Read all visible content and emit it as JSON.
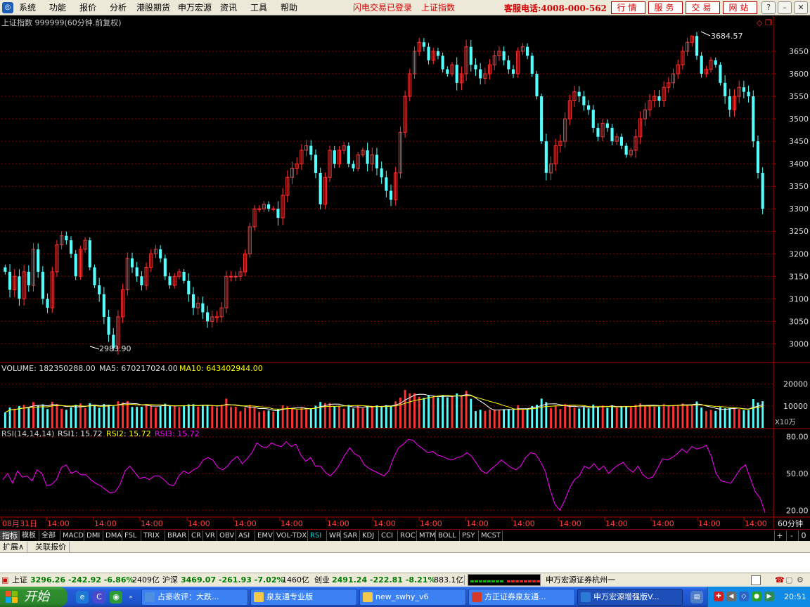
{
  "menu": {
    "items": [
      "系统",
      "功能",
      "报价",
      "分析",
      "港股期货",
      "申万宏源",
      "资讯",
      "工具",
      "帮助"
    ],
    "status_login": "闪电交易已登录",
    "status_index": "上证指数",
    "hotline": "客服电话:4008-000-562",
    "quick_buttons": [
      "行情",
      "服务",
      "交易",
      "网站"
    ],
    "window_buttons": [
      "?",
      "–",
      "❐",
      "✕"
    ]
  },
  "chart_header": {
    "title": "上证指数 999999(60分钟.前复权)",
    "high_label": "3684.57",
    "low_label": "2983.90"
  },
  "volume_header": {
    "volume": "VOLUME: 182350288.00",
    "ma5": "MA5: 670217024.00",
    "ma10": "MA10: 643402944.00",
    "unit": "X10万"
  },
  "rsi_header": {
    "name": "RSI(14,14,14)",
    "rsi1": "RSI1: 15.72",
    "rsi2": "RSI2: 15.72",
    "rsi3": "RSI3: 15.72"
  },
  "time_axis": {
    "labels": [
      "08月31日",
      "14:00",
      "14:00",
      "14:00",
      "14:00",
      "14:00",
      "14:00",
      "14:00",
      "14:00",
      "14:00",
      "14:00",
      "14:00",
      "14:00",
      "14:00",
      "14:00",
      "14:00",
      "14:00",
      "14:00"
    ],
    "period": "60分钟"
  },
  "indicator_tabs": [
    "指标",
    "模板",
    "全部",
    "MACD",
    "DMI",
    "DMA",
    "FSL",
    "TRIX",
    "BRAR",
    "CR",
    "VR",
    "OBV",
    "ASI",
    "EMV",
    "VOL-TDX",
    "RSI",
    "WR",
    "SAR",
    "KDJ",
    "CCI",
    "ROC",
    "MTM",
    "BOLL",
    "PSY",
    "MCST"
  ],
  "selected_tab": "RSI",
  "tab_controls": [
    "+",
    "-",
    "0"
  ],
  "ext_tabs": [
    "扩展∧",
    "关联报价"
  ],
  "status_bar": {
    "sh_label": "上证",
    "sh_value": "3296.26 -242.92 -6.86%",
    "sh_amount": "2409亿",
    "hs_label": "沪深",
    "hs_value": "3469.07 -261.93 -7.02%",
    "hs_amount": "1460亿",
    "cy_label": "创业",
    "cy_value": "2491.24 -222.81 -8.21%",
    "cy_amount": "883.1亿",
    "broker": "申万宏源证券杭州一"
  },
  "taskbar": {
    "start": "开始",
    "tasks": [
      "占豪收评：大跌...",
      "泉友通专业版",
      "new_swhy_v6",
      "方正证券泉友通...",
      "申万宏源增强版V..."
    ],
    "clock": "20:51"
  },
  "colors": {
    "up": "#ff3232",
    "down": "#54ffff",
    "ma5": "#ffffff",
    "ma10": "#ffff00",
    "rsi": "#ff00ff",
    "grid": "#8b0000"
  },
  "chart_data": [
    {
      "type": "candlestick",
      "title": "上证指数 999999(60分钟.前复权)",
      "x_labels": [
        "08月31日",
        "14:00",
        "14:00",
        "14:00",
        "14:00",
        "14:00",
        "14:00",
        "14:00",
        "14:00",
        "14:00",
        "14:00",
        "14:00",
        "14:00",
        "14:00",
        "14:00",
        "14:00",
        "14:00",
        "14:00"
      ],
      "ylim": [
        2960,
        3700
      ],
      "yticks": [
        3000,
        3050,
        3100,
        3150,
        3200,
        3250,
        3300,
        3350,
        3400,
        3450,
        3500,
        3550,
        3600,
        3650
      ],
      "close": [
        3160,
        3120,
        3150,
        3100,
        3160,
        3130,
        3210,
        3160,
        3100,
        3080,
        3160,
        3220,
        3240,
        3230,
        3200,
        3150,
        3210,
        3230,
        3170,
        3130,
        3110,
        3060,
        3020,
        2990,
        3060,
        3120,
        3190,
        3170,
        3150,
        3130,
        3170,
        3200,
        3210,
        3190,
        3150,
        3130,
        3150,
        3160,
        3140,
        3110,
        3080,
        3090,
        3070,
        3050,
        3060,
        3060,
        3080,
        3150,
        3150,
        3150,
        3160,
        3200,
        3260,
        3300,
        3300,
        3310,
        3300,
        3300,
        3280,
        3330,
        3370,
        3390,
        3400,
        3430,
        3440,
        3420,
        3380,
        3310,
        3370,
        3430,
        3400,
        3430,
        3440,
        3400,
        3390,
        3420,
        3430,
        3400,
        3420,
        3390,
        3370,
        3340,
        3320,
        3380,
        3470,
        3550,
        3600,
        3650,
        3670,
        3660,
        3630,
        3650,
        3640,
        3610,
        3600,
        3620,
        3580,
        3600,
        3660,
        3620,
        3610,
        3590,
        3600,
        3620,
        3640,
        3650,
        3630,
        3610,
        3600,
        3650,
        3660,
        3640,
        3600,
        3550,
        3450,
        3380,
        3400,
        3440,
        3450,
        3500,
        3540,
        3560,
        3550,
        3530,
        3520,
        3480,
        3460,
        3490,
        3480,
        3450,
        3460,
        3440,
        3420,
        3430,
        3460,
        3500,
        3520,
        3540,
        3550,
        3540,
        3570,
        3580,
        3600,
        3620,
        3650,
        3670,
        3684,
        3640,
        3600,
        3610,
        3630,
        3620,
        3580,
        3550,
        3520,
        3550,
        3570,
        3560,
        3550,
        3450,
        3380,
        3300
      ],
      "high": 3684.57,
      "low": 2983.9
    },
    {
      "type": "bar",
      "title": "VOLUME",
      "unit": "X10万",
      "ylim": [
        0,
        25000
      ],
      "yticks": [
        10000,
        20000
      ],
      "series": [
        {
          "name": "MA5",
          "value": 670217024.0
        },
        {
          "name": "MA10",
          "value": 643402944.0
        }
      ]
    },
    {
      "type": "line",
      "title": "RSI(14,14,14)",
      "ylim": [
        15,
        85
      ],
      "yticks": [
        20,
        50,
        80
      ],
      "series": [
        {
          "name": "RSI1",
          "values": [
            45,
            50,
            42,
            52,
            47,
            48,
            44,
            53,
            50,
            40,
            41,
            45,
            55,
            57,
            50,
            52,
            49,
            49,
            45,
            42,
            40,
            37,
            34,
            35,
            41,
            52,
            56,
            51,
            46,
            47,
            45,
            48,
            48,
            45,
            41,
            40,
            48,
            52,
            50,
            53,
            55,
            61,
            63,
            61,
            55,
            53,
            56,
            61,
            64,
            58,
            62,
            67,
            75,
            72,
            71,
            75,
            73,
            72,
            76,
            72,
            74,
            65,
            60,
            63,
            56,
            56,
            51,
            48,
            52,
            58,
            65,
            71,
            66,
            64,
            57,
            54,
            52,
            50,
            48,
            52,
            63,
            71,
            74,
            78,
            77,
            73,
            70,
            67,
            68,
            65,
            64,
            62,
            61,
            63,
            64,
            67,
            64,
            58,
            52,
            50,
            54,
            57,
            61,
            58,
            55,
            53,
            56,
            63,
            67,
            66,
            60,
            52,
            37,
            25,
            20,
            28,
            38,
            45,
            48,
            56,
            54,
            58,
            53,
            56,
            50,
            54,
            57,
            59,
            54,
            51,
            56,
            49,
            46,
            47,
            54,
            62,
            61,
            63,
            66,
            70,
            67,
            72,
            70,
            71,
            73,
            64,
            50,
            44,
            43,
            42,
            48,
            54,
            57,
            46,
            35,
            30,
            18
          ]
        }
      ]
    }
  ]
}
